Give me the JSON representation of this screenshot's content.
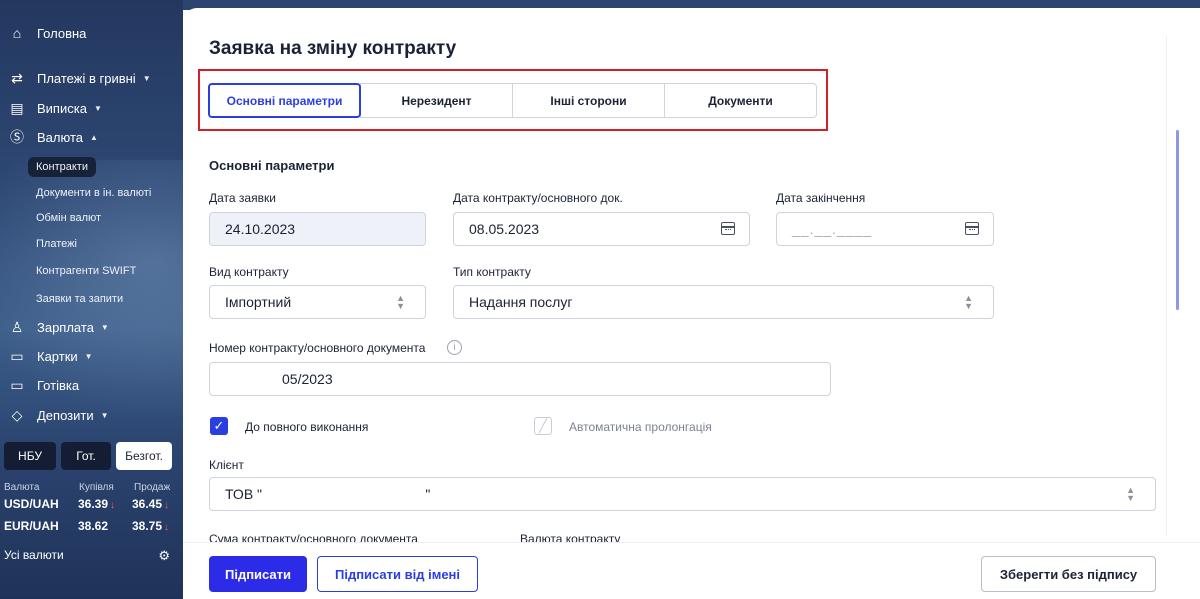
{
  "sidebar": {
    "items": [
      {
        "label": "Головна",
        "icon": "home-icon",
        "glyph": "⌂",
        "has_caret": false
      },
      {
        "label": "Платежі в гривні",
        "icon": "transfer-icon",
        "glyph": "⇄",
        "has_caret": true
      },
      {
        "label": "Виписка",
        "icon": "statement-icon",
        "glyph": "▤",
        "has_caret": true
      },
      {
        "label": "Валюта",
        "icon": "currency-icon",
        "glyph": "Ⓢ",
        "has_caret": true,
        "expanded": true
      },
      {
        "label": "Зарплата",
        "icon": "people-icon",
        "glyph": "♙",
        "has_caret": true
      },
      {
        "label": "Картки",
        "icon": "card-icon",
        "glyph": "▭",
        "has_caret": true
      },
      {
        "label": "Готівка",
        "icon": "cash-icon",
        "glyph": "▭",
        "has_caret": false
      },
      {
        "label": "Депозити",
        "icon": "deposit-icon",
        "glyph": "◇",
        "has_caret": true
      }
    ],
    "currency_subitems": [
      {
        "label": "Контракти",
        "active": true
      },
      {
        "label": "Документи в ін. валюті",
        "active": false
      },
      {
        "label": "Обмін валют",
        "active": false
      },
      {
        "label": "Платежі",
        "active": false
      },
      {
        "label": "Контрагенти SWIFT",
        "active": false
      },
      {
        "label": "Заявки та запити",
        "active": false
      }
    ],
    "rates": {
      "tabs": [
        {
          "label": "НБУ",
          "active": false
        },
        {
          "label": "Гот.",
          "active": false
        },
        {
          "label": "Безгот.",
          "active": true
        }
      ],
      "headers": {
        "currency": "Валюта",
        "buy": "Купівля",
        "sell": "Продаж"
      },
      "rows": [
        {
          "pair": "USD/UAH",
          "buy": "36.39",
          "sell": "36.45",
          "buy_arrow": "↓",
          "sell_arrow": "↓"
        },
        {
          "pair": "EUR/UAH",
          "buy": "38.62",
          "sell": "38.75",
          "buy_arrow": "",
          "sell_arrow": "↓"
        }
      ],
      "all_label": "Усі валюти",
      "gear_icon": "⚙"
    }
  },
  "page": {
    "title": "Заявка на зміну контракту",
    "tabs": [
      {
        "label": "Основні параметри",
        "active": true
      },
      {
        "label": "Нерезидент",
        "active": false
      },
      {
        "label": "Інші сторони",
        "active": false
      },
      {
        "label": "Документи",
        "active": false
      }
    ],
    "section_title": "Основні параметри",
    "fields": {
      "request_date": {
        "label": "Дата заявки",
        "value": "24.10.2023"
      },
      "contract_date": {
        "label": "Дата контракту/основного док.",
        "value": "08.05.2023"
      },
      "end_date": {
        "label": "Дата закінчення",
        "placeholder": "__.__.____"
      },
      "contract_kind": {
        "label": "Вид контракту",
        "value": "Імпортний"
      },
      "contract_type": {
        "label": "Тип контракту",
        "value": "Надання послуг"
      },
      "contract_number": {
        "label": "Номер контракту/основного документа",
        "value": "05/2023"
      },
      "full_execution": {
        "label": "До повного виконання",
        "checked": true
      },
      "auto_prolong": {
        "label": "Автоматична пролонгація",
        "checked": false
      },
      "client": {
        "label": "Клієнт",
        "value": "ТОВ \"                                          \""
      },
      "contract_sum": {
        "label": "Сума контракту/основного документа"
      },
      "contract_currency": {
        "label": "Валюта контракту"
      }
    },
    "info_glyph": "i",
    "check_glyph": "✓",
    "disabled_check_glyph": "╱",
    "select_glyph": "⌃⌄"
  },
  "footer": {
    "sign_label": "Підписати",
    "sign_as_label": "Підписати від імені",
    "save_label": "Зберегти без підпису"
  },
  "colors": {
    "accent": "#2b3fe0",
    "primary_button": "#2b2be8",
    "highlight_border": "#d1202a",
    "sidebar": "#2e4a76"
  }
}
